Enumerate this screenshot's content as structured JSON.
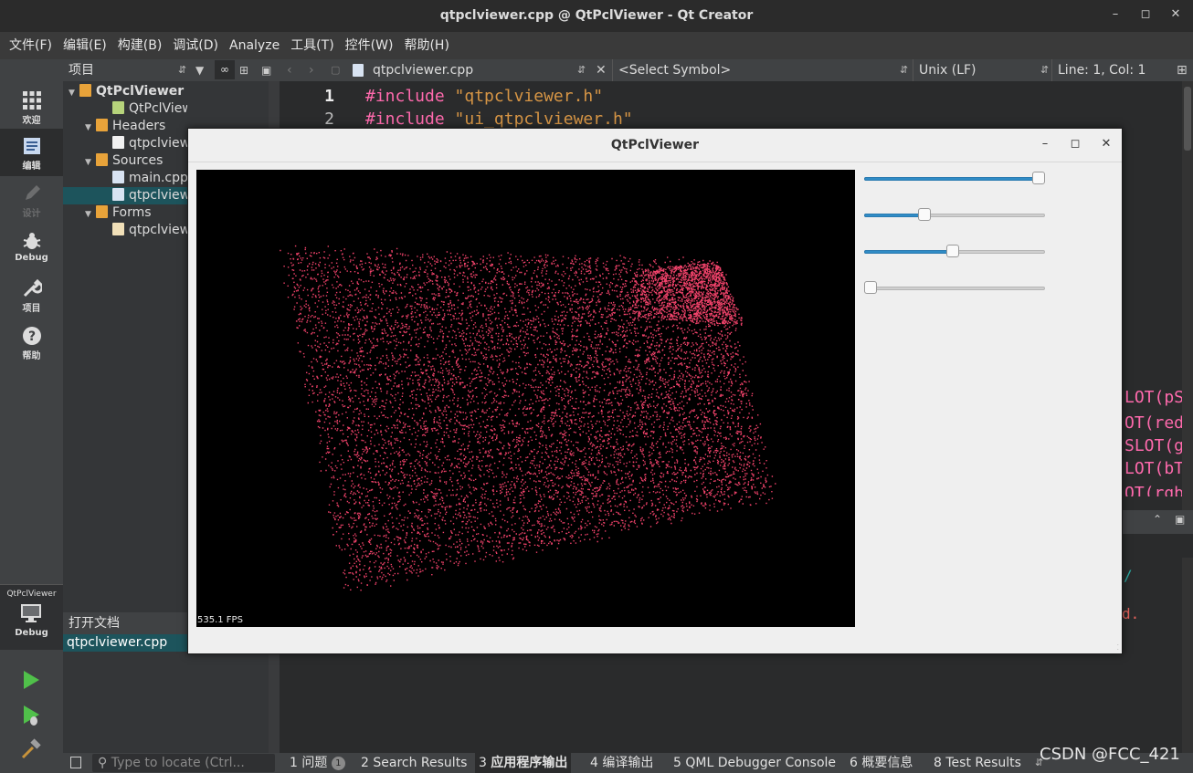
{
  "window": {
    "title": "qtpclviewer.cpp @ QtPclViewer - Qt Creator"
  },
  "menu": [
    "文件(F)",
    "编辑(E)",
    "构建(B)",
    "调试(D)",
    "Analyze",
    "工具(T)",
    "控件(W)",
    "帮助(H)"
  ],
  "modes": [
    {
      "label": "欢迎",
      "icon": "grid-icon"
    },
    {
      "label": "编辑",
      "icon": "edit-icon"
    },
    {
      "label": "设计",
      "icon": "pencil-icon"
    },
    {
      "label": "Debug",
      "icon": "bug-icon"
    },
    {
      "label": "项目",
      "icon": "wrench-icon"
    },
    {
      "label": "帮助",
      "icon": "help-icon"
    }
  ],
  "kit": {
    "project": "QtPclViewer",
    "config": "Debug"
  },
  "projects": {
    "header": "项目",
    "tree": [
      {
        "label": "QtPclViewer",
        "indent": 0,
        "icon": "project-icon",
        "expanded": true,
        "bold": true
      },
      {
        "label": "QtPclViewer.pro",
        "indent": 2,
        "icon": "pro-file-icon"
      },
      {
        "label": "Headers",
        "indent": 1,
        "icon": "headers-folder-icon",
        "expanded": true
      },
      {
        "label": "qtpclviewer.h",
        "indent": 2,
        "icon": "header-file-icon"
      },
      {
        "label": "Sources",
        "indent": 1,
        "icon": "sources-folder-icon",
        "expanded": true
      },
      {
        "label": "main.cpp",
        "indent": 2,
        "icon": "cpp-file-icon"
      },
      {
        "label": "qtpclviewer.cpp",
        "indent": 2,
        "icon": "cpp-file-icon",
        "selected": true
      },
      {
        "label": "Forms",
        "indent": 1,
        "icon": "forms-folder-icon",
        "expanded": true
      },
      {
        "label": "qtpclviewer.ui",
        "indent": 2,
        "icon": "ui-file-icon"
      }
    ]
  },
  "open_documents": {
    "header": "打开文档",
    "items": [
      "qtpclviewer.cpp"
    ]
  },
  "editor_toolbar": {
    "file": "qtpclviewer.cpp",
    "symbol": "<Select Symbol>",
    "line_ending": "Unix (LF)",
    "position": "Line: 1, Col: 1"
  },
  "editor": {
    "lines": [
      {
        "num": "1",
        "kw": "#include",
        "str": "\"qtpclviewer.h\""
      },
      {
        "num": "2",
        "kw": "#include",
        "str": "\"ui_qtpclviewer.h\""
      }
    ],
    "right_snippets": [
      "LOT(pS",
      "OT(red",
      "SLOT(g",
      "LOT(bT",
      "OT(rgb"
    ]
  },
  "output_snippets": [
    "/",
    "d."
  ],
  "statusbar": {
    "locate_placeholder": "Type to locate (Ctrl...",
    "tabs": [
      {
        "num": "1",
        "label": "问题",
        "badge": "1"
      },
      {
        "num": "2",
        "label": "Search Results"
      },
      {
        "num": "3",
        "label": "应用程序输出",
        "active": true
      },
      {
        "num": "4",
        "label": "编译输出"
      },
      {
        "num": "5",
        "label": "QML Debugger Console"
      },
      {
        "num": "6",
        "label": "概要信息"
      },
      {
        "num": "8",
        "label": "Test Results"
      }
    ]
  },
  "app_window": {
    "title": "QtPclViewer",
    "fps": "535.1 FPS",
    "point_color": "#f0426a",
    "sliders": [
      {
        "name": "point-size-slider",
        "value": 1.0
      },
      {
        "name": "red-slider",
        "value": 0.32
      },
      {
        "name": "green-slider",
        "value": 0.49
      },
      {
        "name": "blue-slider",
        "value": 0.0
      }
    ]
  },
  "watermark": "CSDN @FCC_421"
}
